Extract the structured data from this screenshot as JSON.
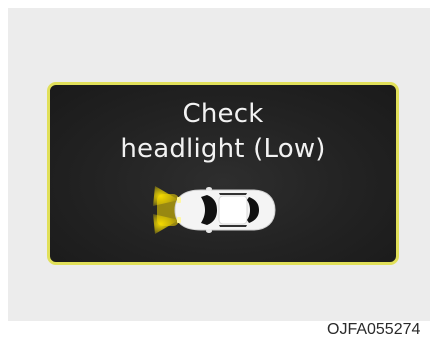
{
  "warning": {
    "line1": "Check",
    "line2": "headlight (Low)",
    "icon": "car-headlight-icon",
    "border_color": "#e1e05a",
    "light_color": "#ffe000"
  },
  "figure_code": "OJFA055274"
}
